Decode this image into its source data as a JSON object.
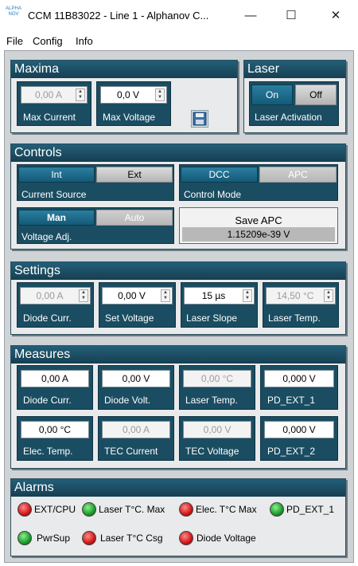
{
  "window": {
    "title": "CCM 11B83022 - Line 1 - Alphanov C...",
    "icon_text": "ALPHA NOV",
    "controls": {
      "minimize": "—",
      "maximize": "☐",
      "close": "✕"
    }
  },
  "menu": [
    "File",
    "Config",
    "Info"
  ],
  "maxima": {
    "title": "Maxima",
    "max_current": {
      "value": "0,00 A",
      "label": "Max Current"
    },
    "max_voltage": {
      "value": "0,0 V",
      "label": "Max Voltage"
    },
    "save_icon": "floppy-disk-icon"
  },
  "laser": {
    "title": "Laser",
    "on": "On",
    "off": "Off",
    "label": "Laser Activation"
  },
  "controls": {
    "title": "Controls",
    "current_source": {
      "opt1": "Int",
      "opt2": "Ext",
      "label": "Current Source"
    },
    "control_mode": {
      "opt1": "DCC",
      "opt2": "APC",
      "label": "Control Mode"
    },
    "voltage_adj": {
      "opt1": "Man",
      "opt2": "Auto",
      "label": "Voltage Adj."
    },
    "save_apc": {
      "label": "Save APC",
      "value": "1.15209e-39 V"
    }
  },
  "settings": {
    "title": "Settings",
    "fields": [
      {
        "value": "0,00 A",
        "label": "Diode Curr.",
        "disabled": true
      },
      {
        "value": "0,00 V",
        "label": "Set Voltage",
        "disabled": false
      },
      {
        "value": "15 µs",
        "label": "Laser Slope",
        "disabled": false
      },
      {
        "value": "14,50 °C",
        "label": "Laser Temp.",
        "disabled": true
      }
    ]
  },
  "measures": {
    "title": "Measures",
    "row1": [
      {
        "value": "0,00 A",
        "label": "Diode Curr.",
        "disabled": false
      },
      {
        "value": "0,00 V",
        "label": "Diode Volt.",
        "disabled": false
      },
      {
        "value": "0,00 °C",
        "label": "Laser Temp.",
        "disabled": true
      },
      {
        "value": "0,000 V",
        "label": "PD_EXT_1",
        "disabled": false
      }
    ],
    "row2": [
      {
        "value": "0,00 °C",
        "label": "Elec. Temp.",
        "disabled": false
      },
      {
        "value": "0,00 A",
        "label": "TEC Current",
        "disabled": true
      },
      {
        "value": "0,00 V",
        "label": "TEC Voltage",
        "disabled": true
      },
      {
        "value": "0,000 V",
        "label": "PD_EXT_2",
        "disabled": false
      }
    ]
  },
  "alarms": {
    "title": "Alarms",
    "items": [
      {
        "label": "EXT/CPU",
        "state": "red"
      },
      {
        "label": "Laser T°C. Max",
        "state": "green"
      },
      {
        "label": "Elec. T°C Max",
        "state": "red"
      },
      {
        "label": "PD_EXT_1",
        "state": "green"
      },
      {
        "label": "PwrSup",
        "state": "green"
      },
      {
        "label": "Laser T°C Csg",
        "state": "red"
      },
      {
        "label": "Diode Voltage",
        "state": "red"
      }
    ],
    "colors": {
      "red": "#d11616",
      "green": "#1b9a2b"
    }
  }
}
